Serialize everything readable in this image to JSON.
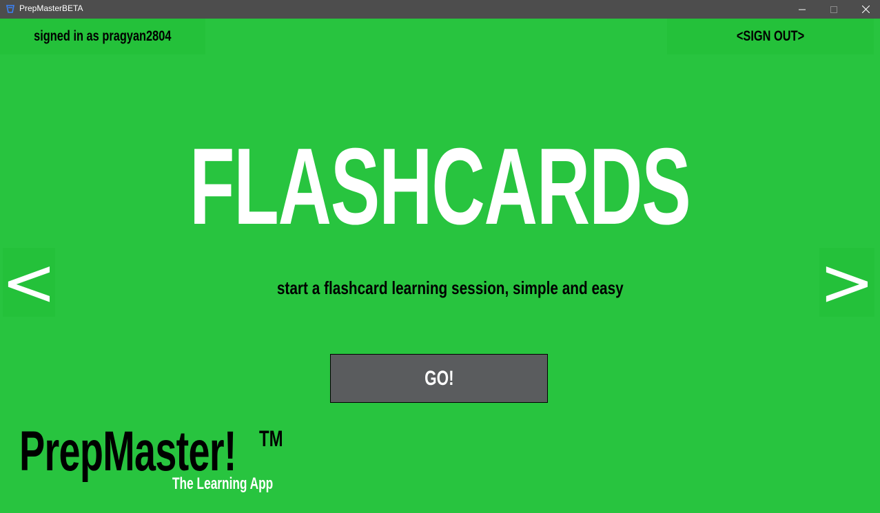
{
  "window": {
    "title": "PrepMasterBETA",
    "icon": "prepmaster-app-icon",
    "controls": [
      "minimize-icon",
      "maximize-icon",
      "close-icon"
    ]
  },
  "header": {
    "signed_in_text": "signed in as pragyan2804",
    "sign_out_label": "<SIGN OUT>"
  },
  "main": {
    "headline": "FLASHCARDS",
    "subtitle": "start a flashcard learning session, simple and easy",
    "go_label": "GO!",
    "prev_label": "<",
    "next_label": ">"
  },
  "branding": {
    "logo_name": "PrepMaster!",
    "logo_tm": "TM",
    "tagline": "The Learning App"
  },
  "colors": {
    "background": "#28c43f",
    "panel": "#24c13a",
    "titlebar": "#4d4d4d",
    "button": "#5a5c5e",
    "text_dark": "#000000",
    "text_light": "#ffffff",
    "icon_blue": "#1f6fd6"
  }
}
